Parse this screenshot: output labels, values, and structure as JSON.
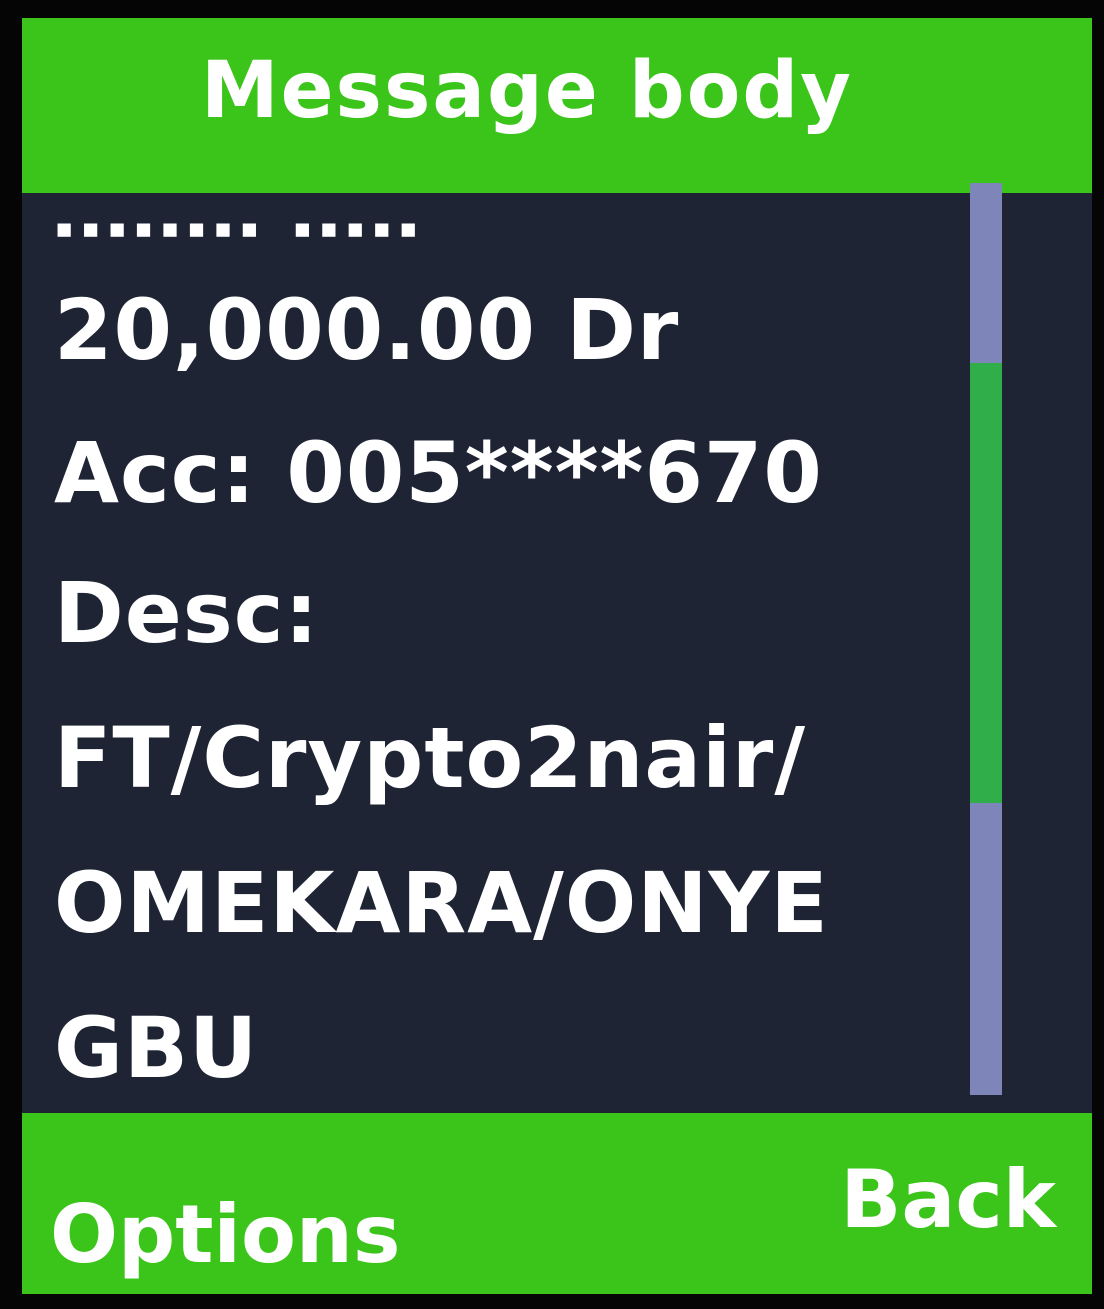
{
  "header": {
    "title": "Message body"
  },
  "message": {
    "lines": [
      "20,000.00 Dr",
      "Acc: 005****670",
      "Desc:",
      "FT/Crypto2nair/",
      "OMEKARA/ONYE",
      "GBU"
    ]
  },
  "scrollbar": {
    "position": 0.55
  },
  "softkeys": {
    "left": "Options",
    "right": "Back"
  },
  "colors": {
    "accent": "#3bc41a",
    "background": "#1e2433",
    "text": "#ffffff",
    "scroll_thumb": "#2fae4a",
    "scroll_caps": "#7e85b8"
  }
}
